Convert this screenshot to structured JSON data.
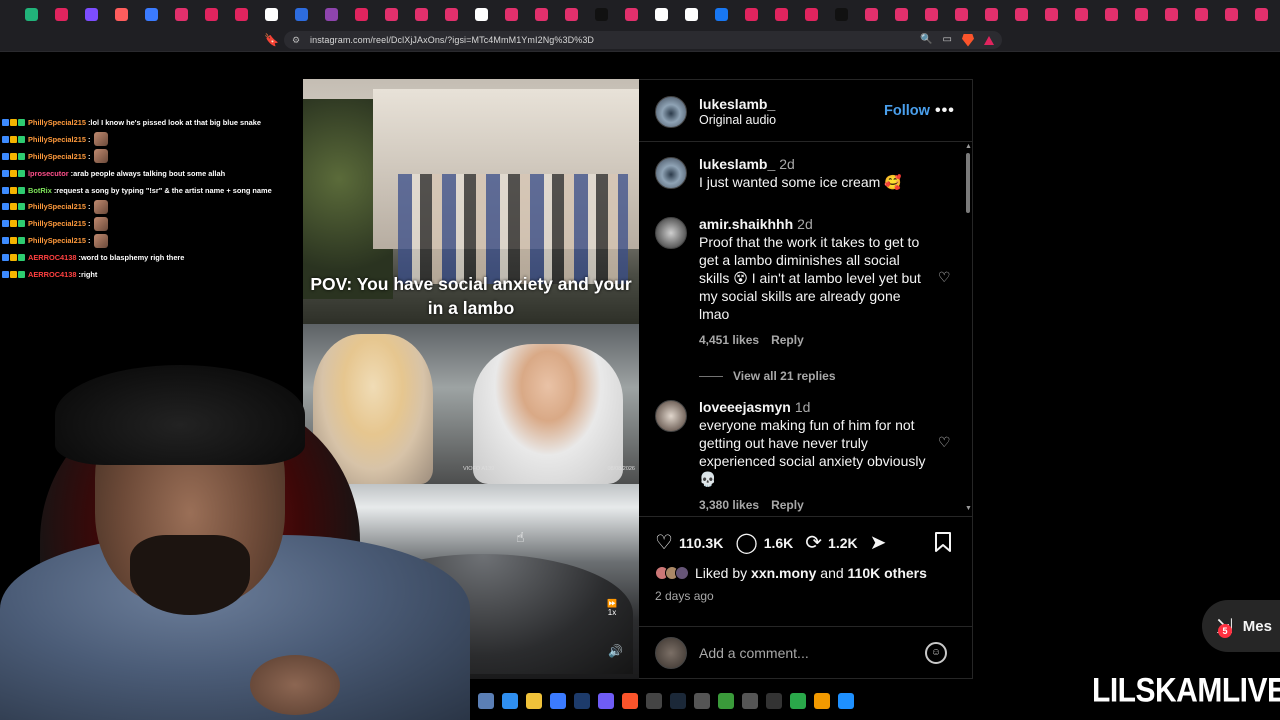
{
  "browser": {
    "url": "instagram.com/reel/DclXjJAxOns/?igsi=MTc4MmM1YmI2Ng%3D%3D"
  },
  "chat": [
    {
      "user": "PhillySpecial215",
      "user_color": "#ff9a3c",
      "sep": " : ",
      "msg": "lol I know he's pissed look at that big blue snake",
      "emote": false
    },
    {
      "user": "PhillySpecial215",
      "user_color": "#ff9a3c",
      "sep": " : ",
      "msg": "",
      "emote": true
    },
    {
      "user": "PhillySpecial215",
      "user_color": "#ff9a3c",
      "sep": " : ",
      "msg": "",
      "emote": true
    },
    {
      "user": "lprosecutor",
      "user_color": "#ff4f8b",
      "sep": " : ",
      "msg": "arab people always talking bout some allah",
      "emote": false
    },
    {
      "user": "BotRix",
      "user_color": "#7ee35a",
      "sep": " : ",
      "msg": "request a song by typing \"!sr\" & the artist name + song name",
      "emote": false
    },
    {
      "user": "PhillySpecial215",
      "user_color": "#ff9a3c",
      "sep": " : ",
      "msg": "",
      "emote": true
    },
    {
      "user": "PhillySpecial215",
      "user_color": "#ff9a3c",
      "sep": " : ",
      "msg": "",
      "emote": true
    },
    {
      "user": "PhillySpecial215",
      "user_color": "#ff9a3c",
      "sep": " : ",
      "msg": "",
      "emote": true
    },
    {
      "user": "AERROC4138",
      "user_color": "#ff4040",
      "sep": " : ",
      "msg": "word to blasphemy righ there",
      "emote": false
    },
    {
      "user": "AERROC4138",
      "user_color": "#ff4040",
      "sep": " : ",
      "msg": "right",
      "emote": false
    }
  ],
  "video": {
    "caption": "POV: You have social anxiety and your in a lambo",
    "watermark": "VIOFO A139",
    "timestamp": "08/08/2026",
    "speed": "1x"
  },
  "post": {
    "author": "lukeslamb_",
    "audio": "Original audio",
    "follow_label": "Follow",
    "more": "•••",
    "likes_count": "110.3K",
    "comments_count": "1.6K",
    "reposts_count": "1.2K",
    "liked_by_prefix": "Liked by ",
    "liked_by_user": "xxn.mony",
    "liked_by_mid": " and ",
    "liked_by_others": "110K others",
    "posted": "2 days ago",
    "comment_placeholder": "Add a comment..."
  },
  "comments": [
    {
      "user": "lukeslamb_",
      "time": "2d",
      "text": "I just wanted some ice cream 🥰",
      "likes": "",
      "reply": ""
    },
    {
      "user": "amir.shaikhhh",
      "time": "2d",
      "text": "Proof that the work it takes to get to get a lambo diminishes all social skills 😵 I ain't at lambo level yet but my social skills are already gone lmao",
      "likes": "4,451 likes",
      "reply": "Reply"
    },
    {
      "user": "loveeejasmyn",
      "time": "1d",
      "text": "everyone making fun of him for not getting out have never truly experienced social anxiety obviously 💀",
      "likes": "3,380 likes",
      "reply": "Reply"
    }
  ],
  "view_replies": "View all 21 replies",
  "messages": {
    "label": "Mes",
    "badge": "5"
  },
  "brand": "LILSKAMLIVE",
  "colors": {
    "accent": "#4a9fec",
    "bg": "#000000",
    "badge": "#ff3040"
  }
}
